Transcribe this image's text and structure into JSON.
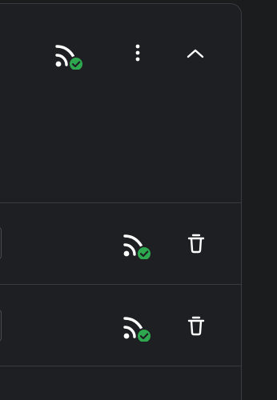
{
  "header": {
    "icons": [
      "rss-feed-icon",
      "check-badge-icon",
      "more-vertical-icon",
      "chevron-up-icon"
    ]
  },
  "feeds": [
    {
      "icons": [
        "rss-feed-icon",
        "check-badge-icon",
        "trash-icon"
      ]
    },
    {
      "icons": [
        "rss-feed-icon",
        "check-badge-icon",
        "trash-icon"
      ]
    }
  ],
  "colors": {
    "background": "#1b1c1e",
    "panel": "#1e1f22",
    "border": "#393b40",
    "icon": "#ffffff",
    "badge_success": "#2ea84f"
  }
}
